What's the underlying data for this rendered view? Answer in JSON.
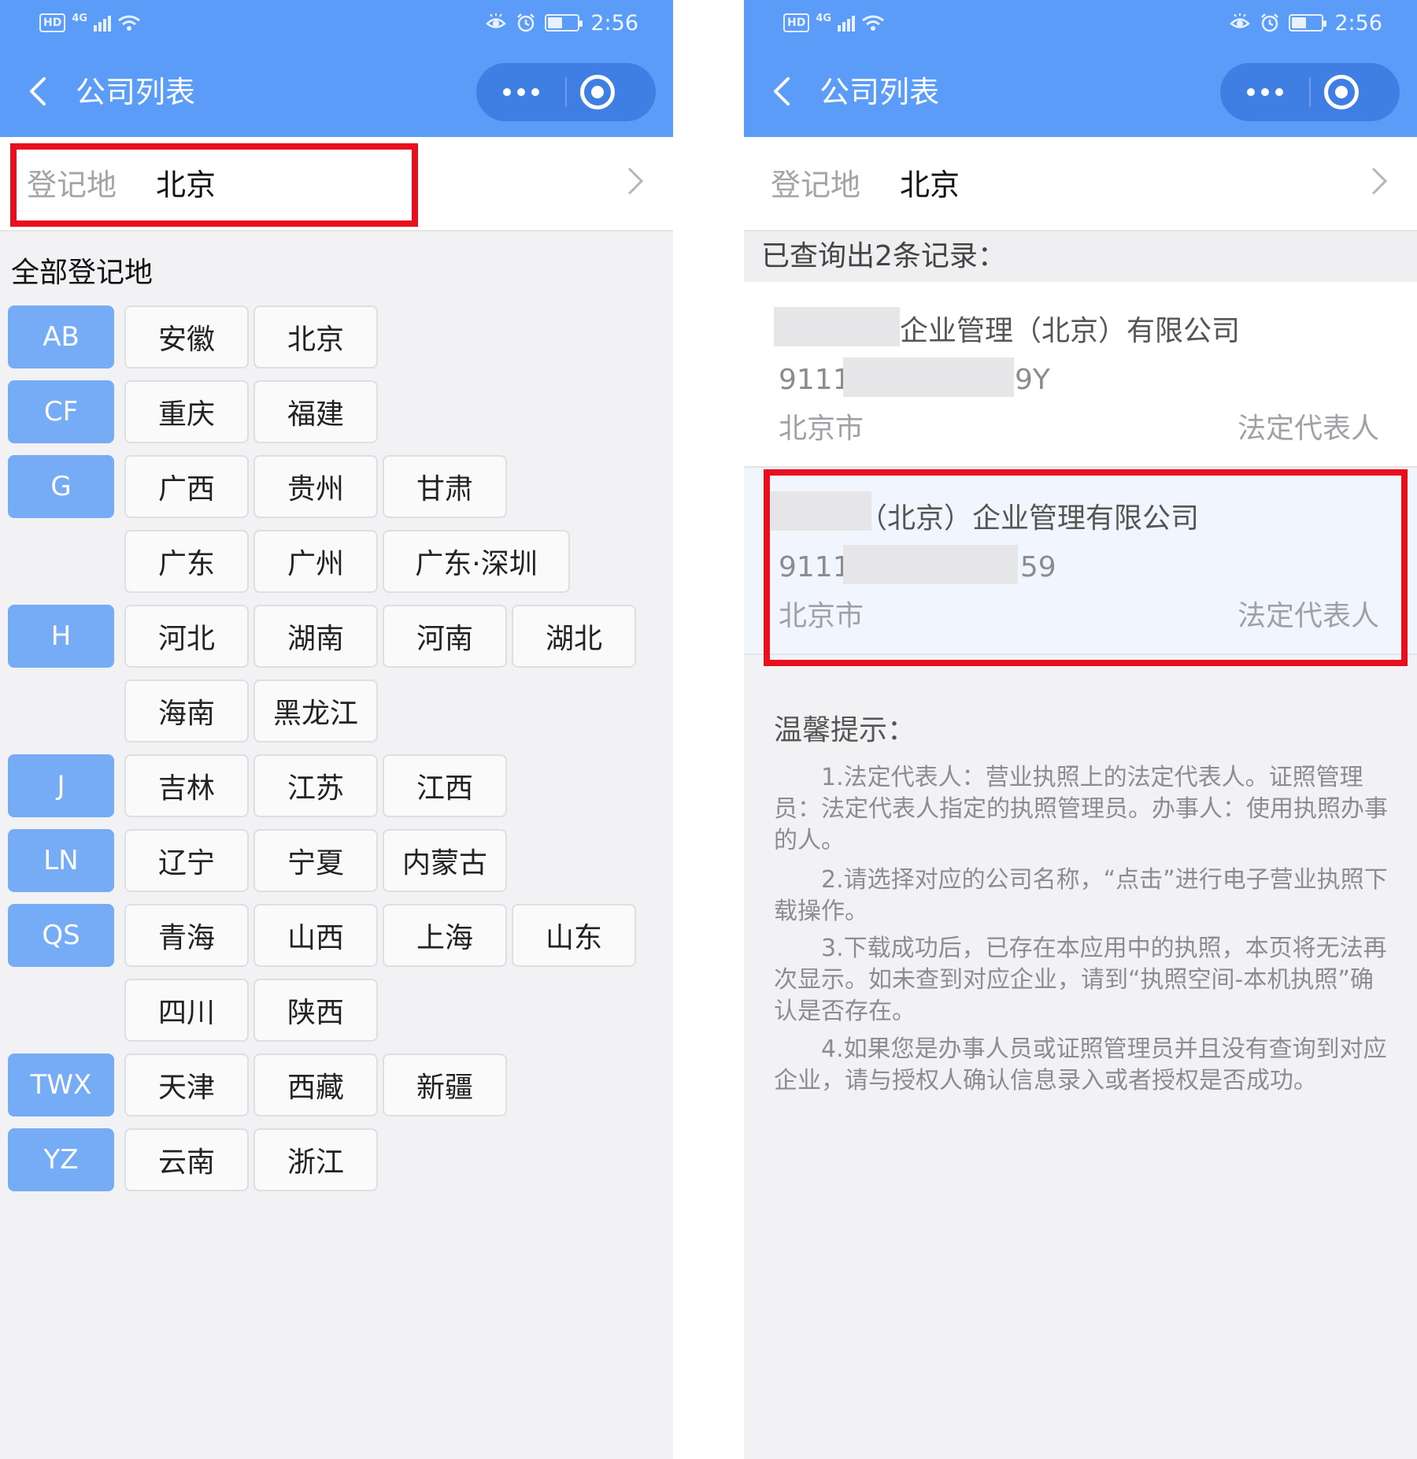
{
  "status_bar": {
    "hd": "HD",
    "network": "4G",
    "time": "2:56",
    "battery_level": 0.45
  },
  "header": {
    "title": "公司列表"
  },
  "picker": {
    "label": "登记地",
    "value": "北京"
  },
  "region_list": {
    "title": "全部登记地",
    "groups": [
      {
        "letter": "AB",
        "rows": [
          [
            "安徽",
            "北京"
          ]
        ]
      },
      {
        "letter": "CF",
        "rows": [
          [
            "重庆",
            "福建"
          ]
        ]
      },
      {
        "letter": "G",
        "rows": [
          [
            "广西",
            "贵州",
            "甘肃"
          ],
          [
            "广东",
            "广州",
            "广东·深圳"
          ]
        ]
      },
      {
        "letter": "H",
        "rows": [
          [
            "河北",
            "湖南",
            "河南",
            "湖北"
          ],
          [
            "海南",
            "黑龙江"
          ]
        ]
      },
      {
        "letter": "J",
        "rows": [
          [
            "吉林",
            "江苏",
            "江西"
          ]
        ]
      },
      {
        "letter": "LN",
        "rows": [
          [
            "辽宁",
            "宁夏",
            "内蒙古"
          ]
        ]
      },
      {
        "letter": "QS",
        "rows": [
          [
            "青海",
            "山西",
            "上海",
            "山东"
          ],
          [
            "四川",
            "陕西"
          ]
        ]
      },
      {
        "letter": "TWX",
        "rows": [
          [
            "天津",
            "西藏",
            "新疆"
          ]
        ]
      },
      {
        "letter": "YZ",
        "rows": [
          [
            "云南",
            "浙江"
          ]
        ]
      }
    ]
  },
  "results": {
    "summary": "已查询出2条记录：",
    "items": [
      {
        "name": "企业管理（北京）有限公司",
        "code_prefix": "9111",
        "code_suffix": "9Y",
        "city": "北京市",
        "role": "法定代表人"
      },
      {
        "name": "（北京）企业管理有限公司",
        "code_prefix": "9111",
        "code_suffix": "759",
        "city": "北京市",
        "role": "法定代表人"
      }
    ]
  },
  "tips": {
    "title": "温馨提示：",
    "items": [
      "1.法定代表人：营业执照上的法定代表人。证照管理员：法定代表人指定的执照管理员。办事人：使用执照办事的人。",
      "2.请选择对应的公司名称，“点击”进行电子营业执照下载操作。",
      "3.下载成功后，已存在本应用中的执照，本页将无法再次显示。如未查到对应企业，请到“执照空间-本机执照”确认是否存在。",
      "4.如果您是办事人员或证照管理员并且没有查询到对应企业，请与授权人确认信息录入或者授权是否成功。"
    ]
  },
  "colors": {
    "header_bg": "#5b9cf9",
    "letter_bg": "#76abf6",
    "highlight": "#e8101e",
    "page_bg": "#f2f2f5"
  }
}
